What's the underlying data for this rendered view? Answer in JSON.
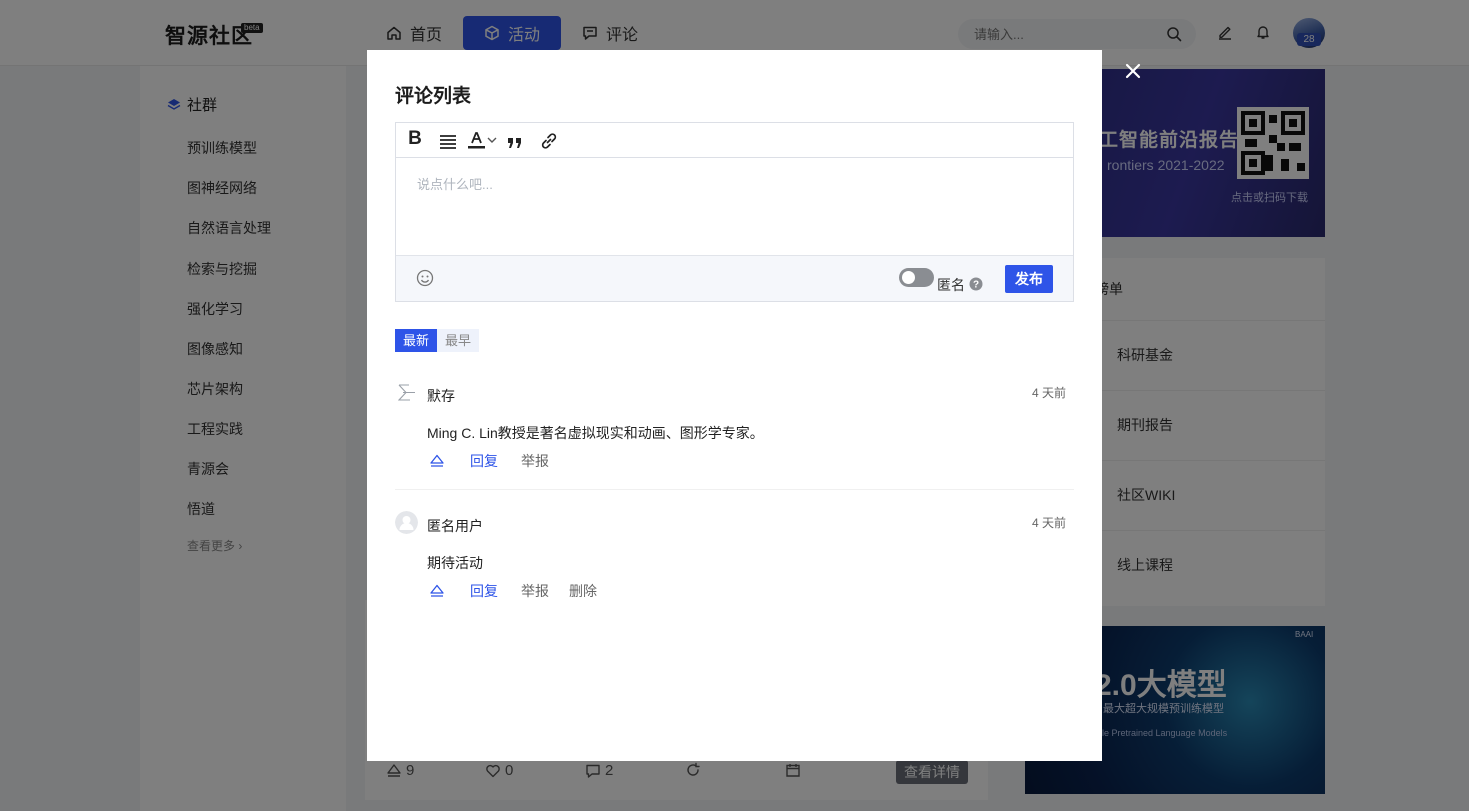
{
  "header": {
    "logo": "智源社区",
    "logo_badge": "beta",
    "nav": [
      {
        "label": "首页",
        "icon": "home-icon"
      },
      {
        "label": "活动",
        "icon": "cube-icon",
        "active": true
      },
      {
        "label": "评论",
        "icon": "comment-icon"
      }
    ],
    "search_placeholder": "请输入...",
    "avatar_badge": "28"
  },
  "sidebar": {
    "heading": "社群",
    "items": [
      "预训练模型",
      "图神经网络",
      "自然语言处理",
      "检索与挖掘",
      "强化学习",
      "图像感知",
      "芯片架构",
      "工程实践",
      "青源会",
      "悟道"
    ],
    "more": "查看更多"
  },
  "feed": {
    "stats": {
      "likes": "9",
      "favorites": "0",
      "comments": "2"
    },
    "detail_button": "查看详情"
  },
  "right": {
    "banner1": {
      "title": "工智能前沿报告",
      "subtitle": "rontiers 2021-2022",
      "cta": "点击或扫码下载"
    },
    "rank_title": "榜单",
    "rank_items": [
      "科研基金",
      "期刊报告",
      "社区WIKI",
      "线上课程"
    ],
    "banner2": {
      "brand": "BAAI",
      "title": "2.0大模型",
      "subtitle": "最大超大规模预训练模型",
      "subtitle2": "ale Pretrained Language Models"
    }
  },
  "modal": {
    "title": "评论列表",
    "editor_placeholder": "说点什么吧...",
    "anonymous_label": "匿名",
    "publish_label": "发布",
    "sort_tabs": [
      {
        "label": "最新",
        "active": true
      },
      {
        "label": "最早",
        "active": false
      }
    ],
    "comments": [
      {
        "author": "默存",
        "time": "4 天前",
        "text": "Ming C. Lin教授是著名虚拟现实和动画、图形学专家。",
        "actions": {
          "reply": "回复",
          "report": "举报"
        }
      },
      {
        "author": "匿名用户",
        "time": "4 天前",
        "text": "期待活动",
        "actions": {
          "reply": "回复",
          "report": "举报",
          "delete": "删除"
        }
      }
    ]
  },
  "colors": {
    "accent": "#2e54e8",
    "overlay": "rgba(0,0,0,0.5)"
  }
}
